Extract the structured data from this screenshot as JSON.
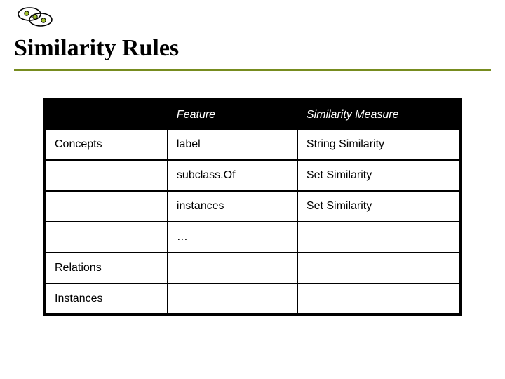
{
  "title": "Similarity Rules",
  "table": {
    "headers": {
      "col1": "",
      "col2": "Feature",
      "col3": "Similarity Measure"
    },
    "rows": [
      {
        "c1": "Concepts",
        "c2": "label",
        "c3": "String Similarity"
      },
      {
        "c1": "",
        "c2": "subclass.Of",
        "c3": "Set Similarity"
      },
      {
        "c1": "",
        "c2": "instances",
        "c3": "Set Similarity"
      },
      {
        "c1": "",
        "c2": "…",
        "c3": ""
      },
      {
        "c1": "Relations",
        "c2": "",
        "c3": ""
      },
      {
        "c1": "Instances",
        "c2": "",
        "c3": ""
      }
    ]
  }
}
